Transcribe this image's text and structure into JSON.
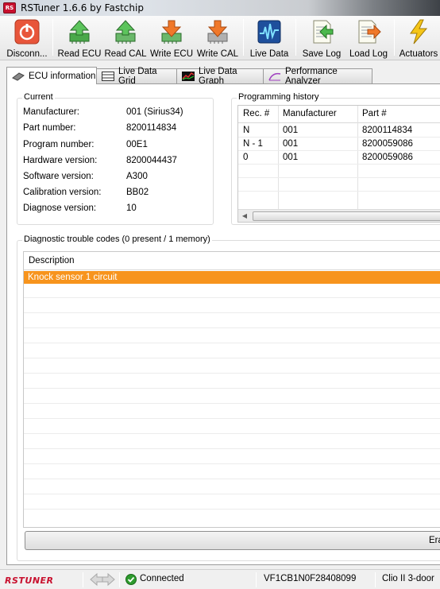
{
  "window": {
    "title": "RSTuner 1.6.6 by Fastchip",
    "app_icon_text": "RS"
  },
  "toolbar": {
    "buttons": [
      {
        "label": "Disconn...",
        "icon": "disconnect-icon"
      },
      {
        "label": "Read ECU",
        "icon": "read-ecu-icon"
      },
      {
        "label": "Read CAL",
        "icon": "read-cal-icon"
      },
      {
        "label": "Write ECU",
        "icon": "write-ecu-icon"
      },
      {
        "label": "Write CAL",
        "icon": "write-cal-icon"
      },
      {
        "label": "Live Data",
        "icon": "live-data-icon"
      },
      {
        "label": "Save Log",
        "icon": "save-log-icon"
      },
      {
        "label": "Load Log",
        "icon": "load-log-icon"
      },
      {
        "label": "Actuators",
        "icon": "actuators-icon"
      }
    ]
  },
  "tabs": [
    {
      "label": "ECU information",
      "active": true
    },
    {
      "label": "Live Data Grid",
      "active": false
    },
    {
      "label": "Live Data Graph",
      "active": false
    },
    {
      "label": "Performance Analyzer",
      "active": false
    }
  ],
  "current": {
    "title": "Current",
    "rows": [
      {
        "label": "Manufacturer:",
        "value": "001 (Sirius34)"
      },
      {
        "label": "Part number:",
        "value": "8200114834"
      },
      {
        "label": "Program number:",
        "value": "00E1"
      },
      {
        "label": "Hardware version:",
        "value": "8200044437"
      },
      {
        "label": "Software version:",
        "value": "A300"
      },
      {
        "label": "Calibration version:",
        "value": "BB02"
      },
      {
        "label": "Diagnose version:",
        "value": "10"
      }
    ]
  },
  "history": {
    "title": "Programming history",
    "columns": [
      "Rec. #",
      "Manufacturer",
      "Part #"
    ],
    "rows": [
      [
        "N",
        "001",
        "8200114834"
      ],
      [
        "N - 1",
        "001",
        "8200059086"
      ],
      [
        "0",
        "001",
        "8200059086"
      ]
    ]
  },
  "dtc": {
    "title": "Diagnostic trouble codes (0 present / 1 memory)",
    "column": "Description",
    "rows": [
      "Knock sensor 1 circuit"
    ],
    "erase_label": "Era"
  },
  "status": {
    "logo": "RSTUNER",
    "connection": "Connected",
    "vin": "VF1CB1N0F28408099",
    "vehicle": "Clio II 3-door"
  },
  "colors": {
    "selection": "#f7941d",
    "logo_red": "#c8102e",
    "connected_green": "#2e9b2e"
  }
}
